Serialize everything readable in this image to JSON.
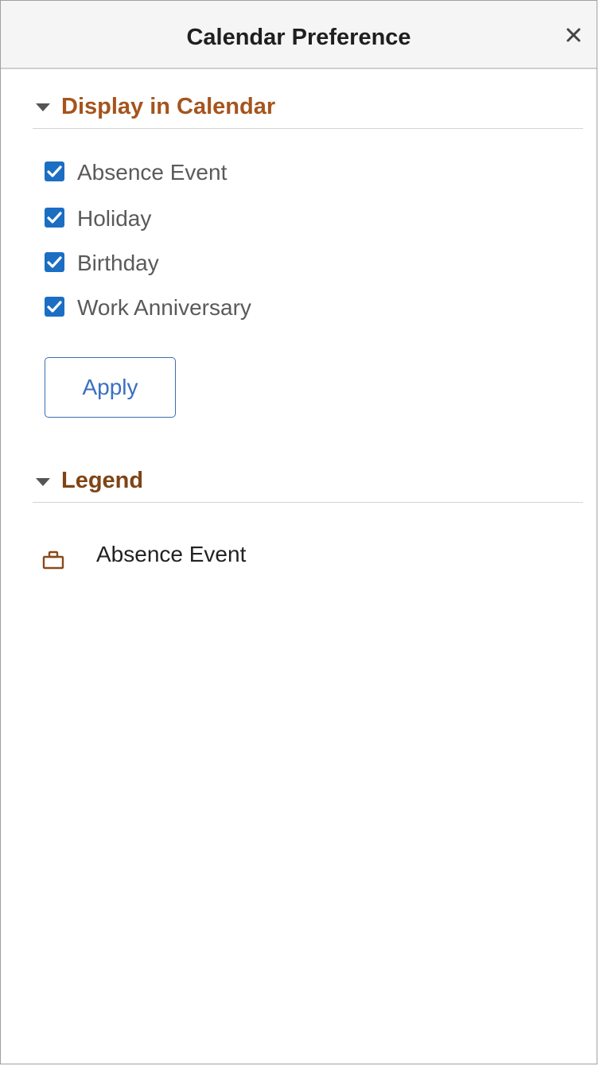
{
  "dialog": {
    "title": "Calendar Preference",
    "close_icon": "close-icon"
  },
  "display_section": {
    "title": "Display in Calendar",
    "expanded": true,
    "options": [
      {
        "label": "Absence Event",
        "checked": true
      },
      {
        "label": "Holiday",
        "checked": true
      },
      {
        "label": "Birthday",
        "checked": true
      },
      {
        "label": "Work Anniversary",
        "checked": true
      }
    ],
    "apply_label": "Apply"
  },
  "legend_section": {
    "title": "Legend",
    "expanded": true,
    "items": [
      {
        "icon": "briefcase-icon",
        "label": "Absence Event"
      }
    ]
  },
  "colors": {
    "display_title": "#a5541e",
    "legend_title": "#7f4415",
    "checkbox": "#1b6ec2",
    "button_text": "#3a6ec2",
    "legend_icon": "#8a4a1a"
  }
}
